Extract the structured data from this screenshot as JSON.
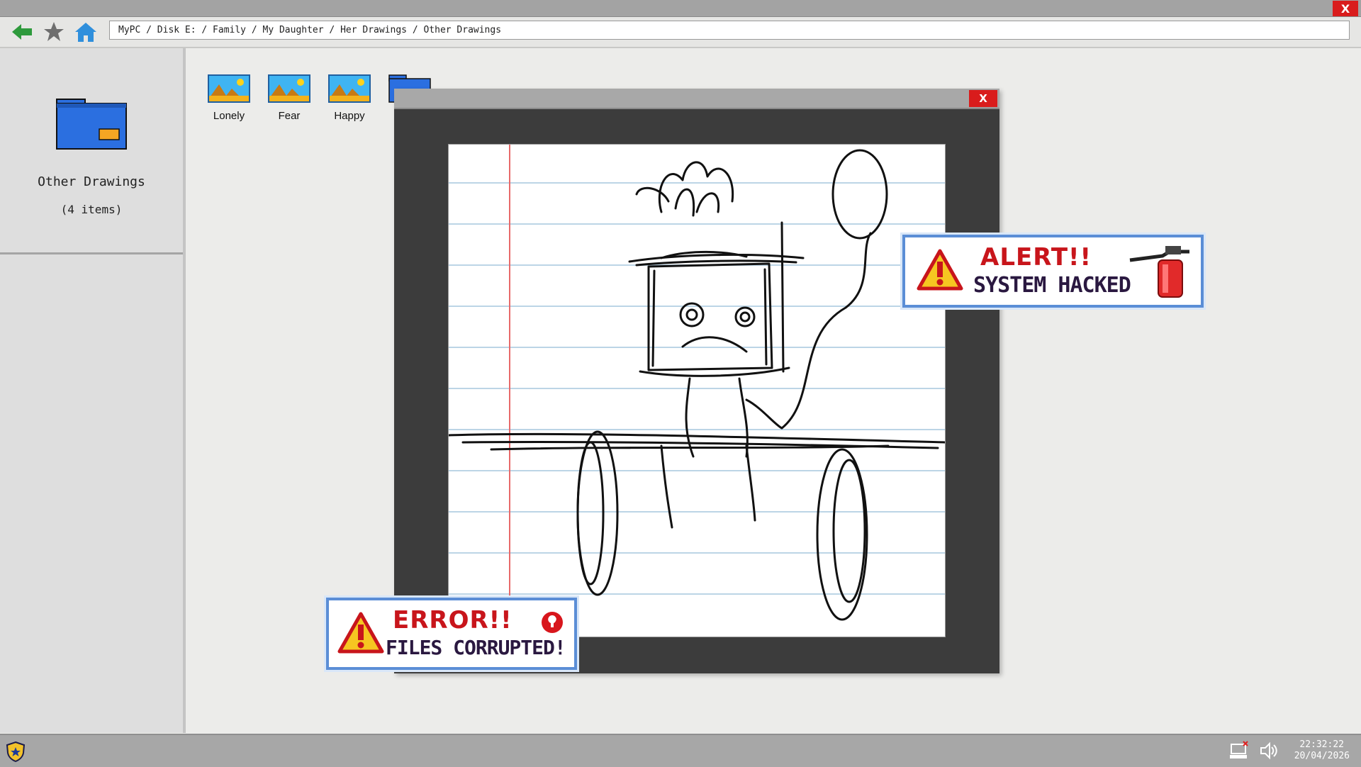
{
  "titlebar": {
    "close_label": "X"
  },
  "toolbar": {
    "back_icon": "back-arrow-icon",
    "favorite_icon": "star-icon",
    "home_icon": "home-icon",
    "path": "MyPC / Disk E: / Family / My Daughter / Her Drawings / Other Drawings"
  },
  "sidebar": {
    "folder_name": "Other Drawings",
    "item_count": "(4 items)"
  },
  "files": [
    {
      "label": "Lonely",
      "icon": "image-file-icon"
    },
    {
      "label": "Fear",
      "icon": "image-file-icon"
    },
    {
      "label": "Happy",
      "icon": "image-file-icon"
    },
    {
      "label": "",
      "icon": "folder-icon"
    }
  ],
  "viewer": {
    "close_label": "X"
  },
  "alert_popup": {
    "title": "ALERT!!",
    "message": "SYSTEM HACKED",
    "icon": "warning-icon",
    "extra_icon": "fire-extinguisher-icon"
  },
  "error_popup": {
    "title": "ERROR!!",
    "message": "FILES CORRUPTED!",
    "icon": "warning-icon",
    "extra_icon": "error-badge-icon"
  },
  "taskbar": {
    "security_icon": "shield-icon",
    "network_icon": "network-disconnected-icon",
    "volume_icon": "volume-icon",
    "time": "22:32:22",
    "date": "20/04/2026"
  },
  "colors": {
    "accent_red": "#d91c1c",
    "folder_blue": "#2b6fe0",
    "popup_border": "#5b8ed6"
  }
}
